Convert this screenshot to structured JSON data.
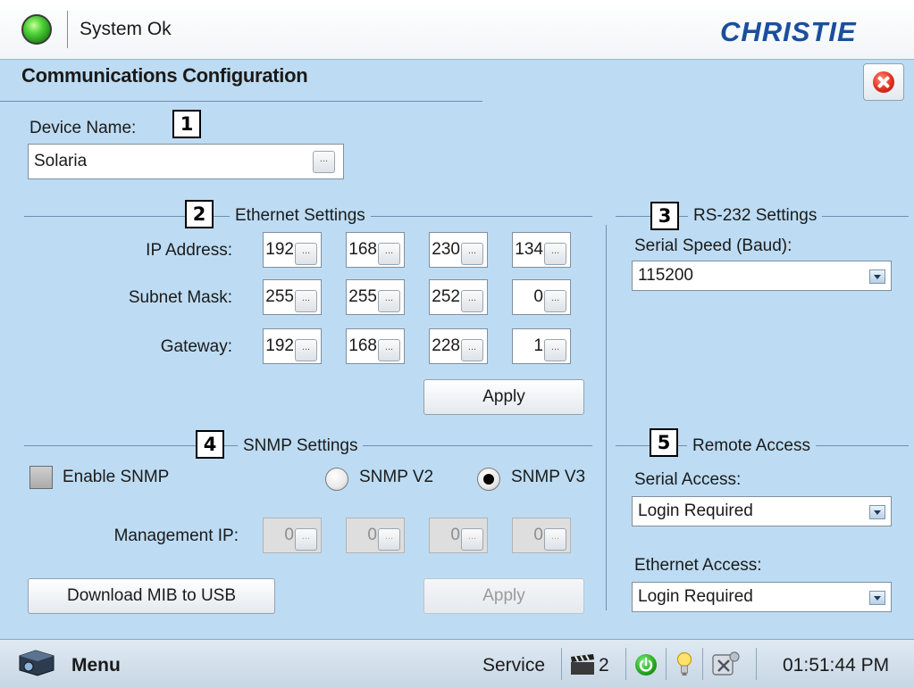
{
  "header": {
    "status_text": "System Ok",
    "status_color": "#2fbf1e",
    "brand": "CHRISTIE",
    "brand_color": "#1b4f9c"
  },
  "page": {
    "title": "Communications Configuration",
    "close_icon": "close-icon"
  },
  "device": {
    "label": "Device Name:",
    "value": "Solaria",
    "callout": "1",
    "ellipsis": "..."
  },
  "ethernet": {
    "callout": "2",
    "title": "Ethernet Settings",
    "ip_label": "IP Address:",
    "ip": [
      "192",
      "168",
      "230",
      "134"
    ],
    "subnet_label": "Subnet Mask:",
    "subnet": [
      "255",
      "255",
      "252",
      "0"
    ],
    "gateway_label": "Gateway:",
    "gateway": [
      "192",
      "168",
      "228",
      "1"
    ],
    "apply_label": "Apply"
  },
  "rs232": {
    "callout": "3",
    "title": "RS-232 Settings",
    "speed_label": "Serial Speed (Baud):",
    "speed_value": "115200"
  },
  "snmp": {
    "callout": "4",
    "title": "SNMP Settings",
    "enable_label": "Enable SNMP",
    "enable_checked": false,
    "v2_label": "SNMP V2",
    "v3_label": "SNMP V3",
    "selected_version": "SNMP V3",
    "mgmt_label": "Management IP:",
    "mgmt_ip": [
      "0",
      "0",
      "0",
      "0"
    ],
    "download_label": "Download MIB to USB",
    "apply_label": "Apply"
  },
  "remote": {
    "callout": "5",
    "title": "Remote Access",
    "serial_label": "Serial Access:",
    "serial_value": "Login Required",
    "ethernet_label": "Ethernet Access:",
    "ethernet_value": "Login Required"
  },
  "footer": {
    "menu_label": "Menu",
    "service_label": "Service",
    "clapper_count": "2",
    "time": "01:51:44 PM"
  }
}
